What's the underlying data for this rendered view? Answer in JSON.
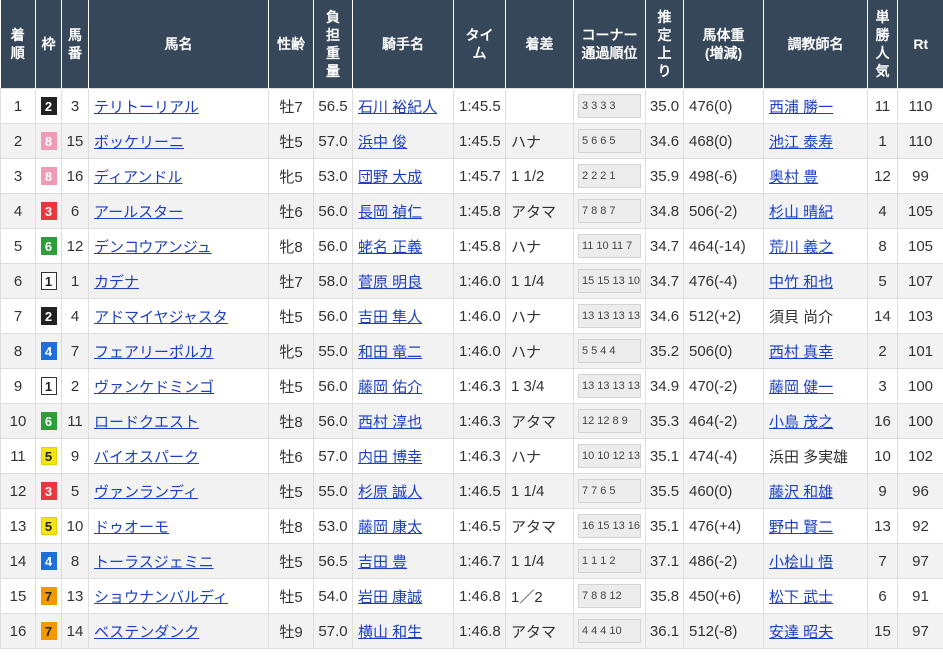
{
  "colors": {
    "header_bg": "#37475a",
    "link": "#1d3fc4",
    "row_alt": "#f2f2f2",
    "grid": "#dedede"
  },
  "frame_colors": {
    "1": {
      "bg": "#ffffff",
      "fg": "#222222",
      "border": "#333333"
    },
    "2": {
      "bg": "#222222",
      "fg": "#ffffff",
      "border": "#222222"
    },
    "3": {
      "bg": "#e8383d",
      "fg": "#ffffff",
      "border": "#e8383d"
    },
    "4": {
      "bg": "#1e6fd9",
      "fg": "#ffffff",
      "border": "#1e6fd9"
    },
    "5": {
      "bg": "#f5e50e",
      "fg": "#222222",
      "border": "#e0d000"
    },
    "6": {
      "bg": "#2e9e3a",
      "fg": "#ffffff",
      "border": "#2e9e3a"
    },
    "7": {
      "bg": "#f39800",
      "fg": "#222222",
      "border": "#f39800"
    },
    "8": {
      "bg": "#f09ab5",
      "fg": "#ffffff",
      "border": "#f09ab5"
    }
  },
  "header": {
    "rank": "着\n順",
    "frame": "枠",
    "number": "馬\n番",
    "horse": "馬名",
    "sex_age": "性齢",
    "weight": "負\n担\n重\n量",
    "jockey": "騎手名",
    "time": "タイ\nム",
    "margin": "着差",
    "corners": "コーナー\n通過順位",
    "last3f": "推\n定\n上\nり",
    "body_weight": "馬体重\n(増減)",
    "trainer": "調教師名",
    "popularity": "単\n勝\n人\n気",
    "rating": "Rt"
  },
  "rows": [
    {
      "rank": "1",
      "frame": "2",
      "number": "3",
      "horse": "テリトーリアル",
      "sex_age": "牡7",
      "weight": "56.5",
      "jockey": "石川 裕紀人",
      "time": "1:45.5",
      "margin": "",
      "corners": [
        "3",
        "3",
        "3",
        "3"
      ],
      "last3f": "35.0",
      "body_weight": "476(0)",
      "trainer": "西浦 勝一",
      "trainer_link": true,
      "popularity": "11",
      "rating": "110"
    },
    {
      "rank": "2",
      "frame": "8",
      "number": "15",
      "horse": "ボッケリーニ",
      "sex_age": "牡5",
      "weight": "57.0",
      "jockey": "浜中 俊",
      "time": "1:45.5",
      "margin": "ハナ",
      "corners": [
        "5",
        "6",
        "6",
        "5"
      ],
      "last3f": "34.6",
      "body_weight": "468(0)",
      "trainer": "池江 泰寿",
      "trainer_link": true,
      "popularity": "1",
      "rating": "110"
    },
    {
      "rank": "3",
      "frame": "8",
      "number": "16",
      "horse": "ディアンドル",
      "sex_age": "牝5",
      "weight": "53.0",
      "jockey": "団野 大成",
      "time": "1:45.7",
      "margin": "1 1/2",
      "corners": [
        "2",
        "2",
        "2",
        "1"
      ],
      "last3f": "35.9",
      "body_weight": "498(-6)",
      "trainer": "奥村 豊",
      "trainer_link": true,
      "popularity": "12",
      "rating": "99"
    },
    {
      "rank": "4",
      "frame": "3",
      "number": "6",
      "horse": "アールスター",
      "sex_age": "牡6",
      "weight": "56.0",
      "jockey": "長岡 禎仁",
      "time": "1:45.8",
      "margin": "アタマ",
      "corners": [
        "7",
        "8",
        "8",
        "7"
      ],
      "last3f": "34.8",
      "body_weight": "506(-2)",
      "trainer": "杉山 晴紀",
      "trainer_link": true,
      "popularity": "4",
      "rating": "105"
    },
    {
      "rank": "5",
      "frame": "6",
      "number": "12",
      "horse": "デンコウアンジュ",
      "sex_age": "牝8",
      "weight": "56.0",
      "jockey": "蛯名 正義",
      "time": "1:45.8",
      "margin": "ハナ",
      "corners": [
        "11",
        "10",
        "11",
        "7"
      ],
      "last3f": "34.7",
      "body_weight": "464(-14)",
      "trainer": "荒川 義之",
      "trainer_link": true,
      "popularity": "8",
      "rating": "105"
    },
    {
      "rank": "6",
      "frame": "1",
      "number": "1",
      "horse": "カデナ",
      "sex_age": "牡7",
      "weight": "58.0",
      "jockey": "菅原 明良",
      "time": "1:46.0",
      "margin": "1 1/4",
      "corners": [
        "15",
        "15",
        "13",
        "10"
      ],
      "last3f": "34.7",
      "body_weight": "476(-4)",
      "trainer": "中竹 和也",
      "trainer_link": true,
      "popularity": "5",
      "rating": "107"
    },
    {
      "rank": "7",
      "frame": "2",
      "number": "4",
      "horse": "アドマイヤジャスタ",
      "sex_age": "牡5",
      "weight": "56.0",
      "jockey": "吉田 隼人",
      "time": "1:46.0",
      "margin": "ハナ",
      "corners": [
        "13",
        "13",
        "13",
        "13"
      ],
      "last3f": "34.6",
      "body_weight": "512(+2)",
      "trainer": "須貝 尚介",
      "trainer_link": false,
      "popularity": "14",
      "rating": "103"
    },
    {
      "rank": "8",
      "frame": "4",
      "number": "7",
      "horse": "フェアリーポルカ",
      "sex_age": "牝5",
      "weight": "55.0",
      "jockey": "和田 竜二",
      "time": "1:46.0",
      "margin": "ハナ",
      "corners": [
        "5",
        "5",
        "4",
        "4"
      ],
      "last3f": "35.2",
      "body_weight": "506(0)",
      "trainer": "西村 真幸",
      "trainer_link": true,
      "popularity": "2",
      "rating": "101"
    },
    {
      "rank": "9",
      "frame": "1",
      "number": "2",
      "horse": "ヴァンケドミンゴ",
      "sex_age": "牡5",
      "weight": "56.0",
      "jockey": "藤岡 佑介",
      "time": "1:46.3",
      "margin": "1 3/4",
      "corners": [
        "13",
        "13",
        "13",
        "13"
      ],
      "last3f": "34.9",
      "body_weight": "470(-2)",
      "trainer": "藤岡 健一",
      "trainer_link": true,
      "popularity": "3",
      "rating": "100"
    },
    {
      "rank": "10",
      "frame": "6",
      "number": "11",
      "horse": "ロードクエスト",
      "sex_age": "牡8",
      "weight": "56.0",
      "jockey": "西村 淳也",
      "time": "1:46.3",
      "margin": "アタマ",
      "corners": [
        "12",
        "12",
        "8",
        "9"
      ],
      "last3f": "35.3",
      "body_weight": "464(-2)",
      "trainer": "小島 茂之",
      "trainer_link": true,
      "popularity": "16",
      "rating": "100"
    },
    {
      "rank": "11",
      "frame": "5",
      "number": "9",
      "horse": "バイオスパーク",
      "sex_age": "牡6",
      "weight": "57.0",
      "jockey": "内田 博幸",
      "time": "1:46.3",
      "margin": "ハナ",
      "corners": [
        "10",
        "10",
        "12",
        "13"
      ],
      "last3f": "35.1",
      "body_weight": "474(-4)",
      "trainer": "浜田 多実雄",
      "trainer_link": false,
      "popularity": "10",
      "rating": "102"
    },
    {
      "rank": "12",
      "frame": "3",
      "number": "5",
      "horse": "ヴァンランディ",
      "sex_age": "牡5",
      "weight": "55.0",
      "jockey": "杉原 誠人",
      "time": "1:46.5",
      "margin": "1 1/4",
      "corners": [
        "7",
        "7",
        "6",
        "5"
      ],
      "last3f": "35.5",
      "body_weight": "460(0)",
      "trainer": "藤沢 和雄",
      "trainer_link": true,
      "popularity": "9",
      "rating": "96"
    },
    {
      "rank": "13",
      "frame": "5",
      "number": "10",
      "horse": "ドゥオーモ",
      "sex_age": "牡8",
      "weight": "53.0",
      "jockey": "藤岡 康太",
      "time": "1:46.5",
      "margin": "アタマ",
      "corners": [
        "16",
        "15",
        "13",
        "16"
      ],
      "last3f": "35.1",
      "body_weight": "476(+4)",
      "trainer": "野中 賢二",
      "trainer_link": true,
      "popularity": "13",
      "rating": "92"
    },
    {
      "rank": "14",
      "frame": "4",
      "number": "8",
      "horse": "トーラスジェミニ",
      "sex_age": "牡5",
      "weight": "56.5",
      "jockey": "吉田 豊",
      "time": "1:46.7",
      "margin": "1 1/4",
      "corners": [
        "1",
        "1",
        "1",
        "2"
      ],
      "last3f": "37.1",
      "body_weight": "486(-2)",
      "trainer": "小桧山 悟",
      "trainer_link": true,
      "popularity": "7",
      "rating": "97"
    },
    {
      "rank": "15",
      "frame": "7",
      "number": "13",
      "horse": "ショウナンバルディ",
      "sex_age": "牡5",
      "weight": "54.0",
      "jockey": "岩田 康誠",
      "time": "1:46.8",
      "margin": "1／2",
      "corners": [
        "7",
        "8",
        "8",
        "12"
      ],
      "last3f": "35.8",
      "body_weight": "450(+6)",
      "trainer": "松下 武士",
      "trainer_link": true,
      "popularity": "6",
      "rating": "91"
    },
    {
      "rank": "16",
      "frame": "7",
      "number": "14",
      "horse": "ベステンダンク",
      "sex_age": "牡9",
      "weight": "57.0",
      "jockey": "横山 和生",
      "time": "1:46.8",
      "margin": "アタマ",
      "corners": [
        "4",
        "4",
        "4",
        "10"
      ],
      "last3f": "36.1",
      "body_weight": "512(-8)",
      "trainer": "安達 昭夫",
      "trainer_link": true,
      "popularity": "15",
      "rating": "97"
    }
  ]
}
